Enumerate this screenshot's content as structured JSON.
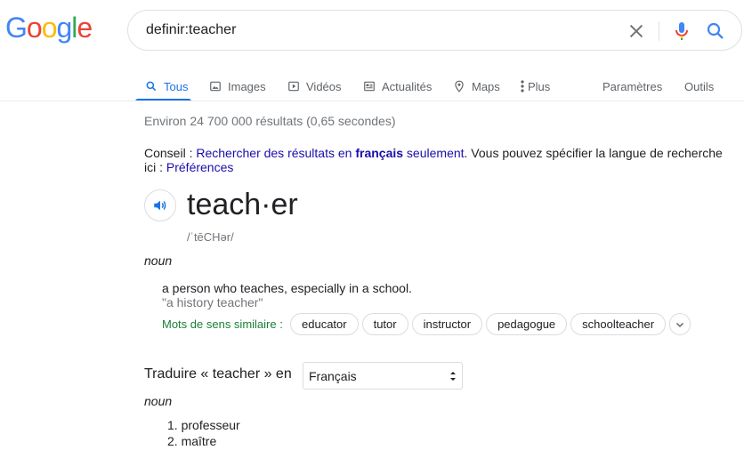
{
  "logo": {
    "letters": [
      {
        "ch": "G",
        "color": "#4285F4"
      },
      {
        "ch": "o",
        "color": "#EA4335"
      },
      {
        "ch": "o",
        "color": "#FBBC05"
      },
      {
        "ch": "g",
        "color": "#4285F4"
      },
      {
        "ch": "l",
        "color": "#34A853"
      },
      {
        "ch": "e",
        "color": "#EA4335"
      }
    ]
  },
  "search": {
    "query": "definir:teacher",
    "icons": {
      "clear": "close-icon",
      "mic": "mic-icon",
      "search": "search-icon"
    }
  },
  "tabs": [
    {
      "label": "Tous",
      "icon": "search-icon",
      "active": true
    },
    {
      "label": "Images",
      "icon": "image-icon",
      "active": false
    },
    {
      "label": "Vidéos",
      "icon": "video-icon",
      "active": false
    },
    {
      "label": "Actualités",
      "icon": "news-icon",
      "active": false
    },
    {
      "label": "Maps",
      "icon": "map-pin-icon",
      "active": false
    },
    {
      "label": "Plus",
      "icon": "more-vert-icon",
      "active": false
    }
  ],
  "tools": {
    "settings": "Paramètres",
    "tools": "Outils"
  },
  "stats": "Environ 24 700 000 résultats (0,65 secondes)",
  "tip": {
    "prefix": "Conseil : ",
    "link1_a": "Rechercher des résultats en ",
    "link1_b": "français",
    "link1_c": " seulement",
    "middle": ". Vous pouvez spécifier la langue de recherche ici : ",
    "link2": "Préférences"
  },
  "dictionary": {
    "word": "teach·er",
    "phonetic": "/ˈtēCHər/",
    "part_of_speech": "noun",
    "definition": "a person who teaches, especially in a school.",
    "example": "\"a history teacher\"",
    "synonyms_label": "Mots de sens similaire :",
    "synonyms": [
      "educator",
      "tutor",
      "instructor",
      "pedagogue",
      "schoolteacher"
    ]
  },
  "translate": {
    "label": "Traduire « teacher » en",
    "language": "Français",
    "part_of_speech": "noun",
    "translations": [
      "professeur",
      "maître"
    ]
  },
  "colors": {
    "accent": "#1a73e8",
    "link": "#1a0dab",
    "synonym_label": "#188038",
    "muted": "#70757a"
  }
}
